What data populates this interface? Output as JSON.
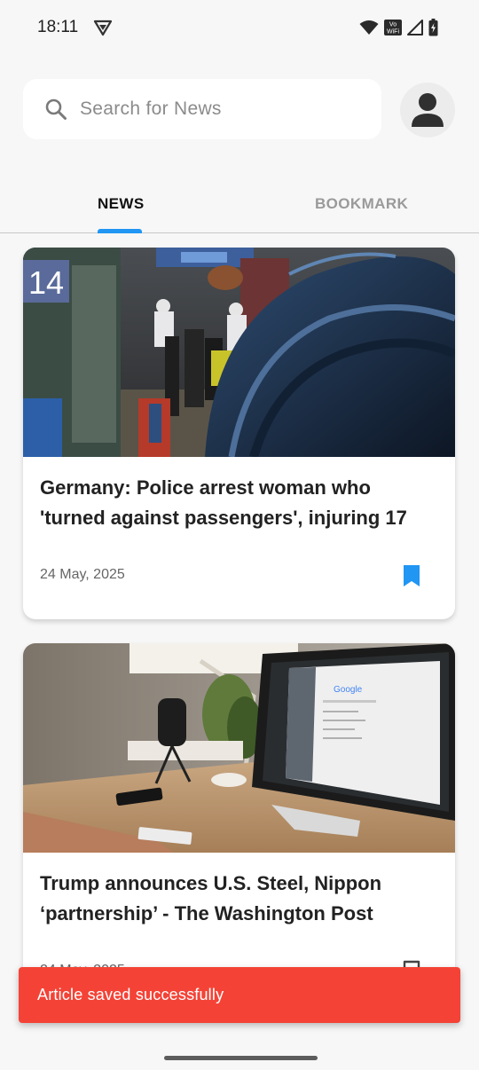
{
  "status_bar": {
    "time": "18:11",
    "vowifi_line1": "Vo",
    "vowifi_line2": "WiFi"
  },
  "search": {
    "placeholder": "Search for News",
    "value": ""
  },
  "tabs": [
    {
      "label": "NEWS",
      "selected": true
    },
    {
      "label": "BOOKMARK",
      "selected": false
    }
  ],
  "articles": [
    {
      "title": "Germany: Police arrest woman who 'turned against passengers', injuring 17",
      "date": "24 May, 2025",
      "bookmarked": true,
      "image_platform_sign": "14"
    },
    {
      "title": "Trump announces U.S. Steel, Nippon ‘partnership’ - The Washington Post",
      "date": "24 May, 2025",
      "bookmarked": false,
      "image_screen_text": "Google"
    }
  ],
  "snackbar": {
    "message": "Article saved successfully"
  },
  "colors": {
    "accent": "#2196f3",
    "snackbar": "#f44336",
    "background": "#f7f7f7"
  },
  "icons": [
    "search-icon",
    "person-icon",
    "bookmark-filled-icon",
    "bookmark-outline-icon",
    "wifi-icon",
    "signal-icon",
    "battery-icon",
    "vpn-icon"
  ]
}
